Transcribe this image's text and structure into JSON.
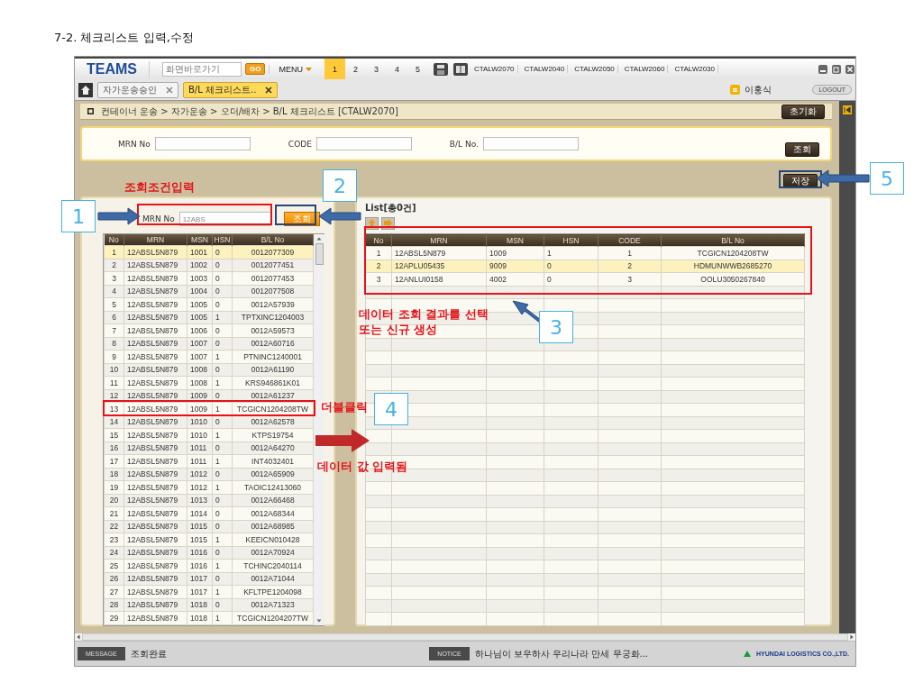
{
  "document_title": "7-2. 체크리스트 입력,수정",
  "app": {
    "logo": "TEAMS",
    "shortcut": {
      "placeholder": "화면바로가기"
    },
    "go_button": "GO",
    "menu": "MENU",
    "page_tabs": [
      {
        "label": "1",
        "selected": true
      },
      {
        "label": "2",
        "selected": false
      },
      {
        "label": "3",
        "selected": false
      },
      {
        "label": "4",
        "selected": false
      },
      {
        "label": "5",
        "selected": false
      }
    ],
    "screen_codes": [
      "CTALW2070",
      "CTALW2040",
      "CTALW2050",
      "CTALW2060",
      "CTALW2030"
    ],
    "doc_tabs": [
      {
        "label": "자가운송승인",
        "selected": false
      },
      {
        "label": "B/L 체크리스트..",
        "selected": true
      }
    ],
    "user": "이홍식",
    "logout": "LOGOUT",
    "breadcrumb": "컨테이너 운송 > 자가운송 > 오더/배차 > B/L 체크리스트 [CTALW2070]",
    "reset_button": "초기화",
    "search_fields": [
      {
        "label": "MRN No"
      },
      {
        "label": "CODE"
      },
      {
        "label": "B/L No."
      }
    ],
    "search_button": "조회",
    "save_button": "저장",
    "left_panel": {
      "field": {
        "label": "MRN No",
        "value": "12ABS"
      },
      "button": "조회",
      "columns": [
        "No",
        "MRN",
        "MSN",
        "HSN",
        "B/L No"
      ],
      "rows": [
        {
          "cells": [
            "1",
            "12ABSL5N879",
            "1001",
            "0",
            "0012077309"
          ],
          "selected": true
        },
        {
          "cells": [
            "2",
            "12ABSL5N879",
            "1002",
            "0",
            "0012077451"
          ],
          "selected": false
        },
        {
          "cells": [
            "3",
            "12ABSL5N879",
            "1003",
            "0",
            "0012077453"
          ],
          "selected": false
        },
        {
          "cells": [
            "4",
            "12ABSL5N879",
            "1004",
            "0",
            "0012077508"
          ],
          "selected": false
        },
        {
          "cells": [
            "5",
            "12ABSL5N879",
            "1005",
            "0",
            "0012A57939"
          ],
          "selected": false
        },
        {
          "cells": [
            "6",
            "12ABSL5N879",
            "1005",
            "1",
            "TPTXINC1204003"
          ],
          "selected": false
        },
        {
          "cells": [
            "7",
            "12ABSL5N879",
            "1006",
            "0",
            "0012A59573"
          ],
          "selected": false
        },
        {
          "cells": [
            "8",
            "12ABSL5N879",
            "1007",
            "0",
            "0012A60716"
          ],
          "selected": false
        },
        {
          "cells": [
            "9",
            "12ABSL5N879",
            "1007",
            "1",
            "PTNINC1240001"
          ],
          "selected": false
        },
        {
          "cells": [
            "10",
            "12ABSL5N879",
            "1008",
            "0",
            "0012A61190"
          ],
          "selected": false
        },
        {
          "cells": [
            "11",
            "12ABSL5N879",
            "1008",
            "1",
            "KRS946861K01"
          ],
          "selected": false
        },
        {
          "cells": [
            "12",
            "12ABSL5N879",
            "1009",
            "0",
            "0012A61237"
          ],
          "selected": false
        },
        {
          "cells": [
            "13",
            "12ABSL5N879",
            "1009",
            "1",
            "TCGICN1204208TW"
          ],
          "selected": false
        },
        {
          "cells": [
            "14",
            "12ABSL5N879",
            "1010",
            "0",
            "0012A62578"
          ],
          "selected": false
        },
        {
          "cells": [
            "15",
            "12ABSL5N879",
            "1010",
            "1",
            "KTPS19754"
          ],
          "selected": false
        },
        {
          "cells": [
            "16",
            "12ABSL5N879",
            "1011",
            "0",
            "0012A64270"
          ],
          "selected": false
        },
        {
          "cells": [
            "17",
            "12ABSL5N879",
            "1011",
            "1",
            "INT4032401"
          ],
          "selected": false
        },
        {
          "cells": [
            "18",
            "12ABSL5N879",
            "1012",
            "0",
            "0012A65909"
          ],
          "selected": false
        },
        {
          "cells": [
            "19",
            "12ABSL5N879",
            "1012",
            "1",
            "TAOIC12413060"
          ],
          "selected": false
        },
        {
          "cells": [
            "20",
            "12ABSL5N879",
            "1013",
            "0",
            "0012A66468"
          ],
          "selected": false
        },
        {
          "cells": [
            "21",
            "12ABSL5N879",
            "1014",
            "0",
            "0012A68344"
          ],
          "selected": false
        },
        {
          "cells": [
            "22",
            "12ABSL5N879",
            "1015",
            "0",
            "0012A68985"
          ],
          "selected": false
        },
        {
          "cells": [
            "23",
            "12ABSL5N879",
            "1015",
            "1",
            "KEEICN010428"
          ],
          "selected": false
        },
        {
          "cells": [
            "24",
            "12ABSL5N879",
            "1016",
            "0",
            "0012A70924"
          ],
          "selected": false
        },
        {
          "cells": [
            "25",
            "12ABSL5N879",
            "1016",
            "1",
            "TCHINC2040114"
          ],
          "selected": false
        },
        {
          "cells": [
            "26",
            "12ABSL5N879",
            "1017",
            "0",
            "0012A71044"
          ],
          "selected": false
        },
        {
          "cells": [
            "27",
            "12ABSL5N879",
            "1017",
            "1",
            "KFLTPE1204098"
          ],
          "selected": false
        },
        {
          "cells": [
            "28",
            "12ABSL5N879",
            "1018",
            "0",
            "0012A71323"
          ],
          "selected": false
        },
        {
          "cells": [
            "29",
            "12ABSL5N879",
            "1018",
            "1",
            "TCGICN1204207TW"
          ],
          "selected": false
        }
      ]
    },
    "right_panel": {
      "title": "List[총0건]",
      "columns": [
        "No",
        "MRN",
        "MSN",
        "HSN",
        "CODE",
        "B/L No"
      ],
      "rows": [
        {
          "cells": [
            "1",
            "12ABSL5N879",
            "1009",
            "1",
            "1",
            "TCGICN1204208TW"
          ],
          "selected": false
        },
        {
          "cells": [
            "2",
            "12APLU05435",
            "9009",
            "0",
            "2",
            "HDMUNWWB2685270"
          ],
          "selected": true
        },
        {
          "cells": [
            "3",
            "12ANLUI0158",
            "4002",
            "0",
            "3",
            "OOLU3050267840"
          ],
          "selected": false
        }
      ]
    },
    "status": {
      "message_label": "MESSAGE",
      "message": "조회완료",
      "notice_label": "NOTICE",
      "notice": "하나님이 보우하사 우리나라 만세 무궁화...",
      "company": "HYUNDAI LOGISTICS CO.,LTD."
    }
  },
  "annotations": {
    "callouts": [
      "1",
      "2",
      "3",
      "4",
      "5"
    ],
    "notes": [
      "조회조건입력",
      "데이터 조회 결과를 선택\n또는 신규 생성",
      "더블클릭",
      "데이터 값 입력됨"
    ]
  }
}
